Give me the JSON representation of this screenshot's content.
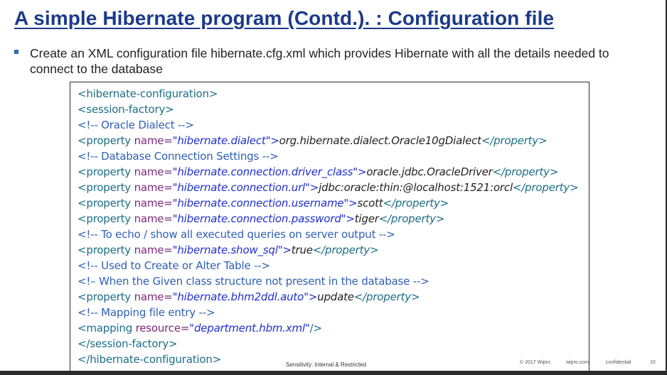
{
  "slide": {
    "title": "A simple Hibernate program (Contd.). : Configuration file",
    "bullet": "Create an XML configuration file hibernate.cfg.xml which provides Hibernate with all the details needed to connect to the database"
  },
  "code": {
    "l1": "<hibernate-configuration>",
    "l2": "<session-factory>",
    "l3": "<!-- Oracle Dialect -->",
    "l4": {
      "open": "<property ",
      "attr": "name=",
      "q1": "\"",
      "val": "hibernate.dialect",
      "q2": "\">",
      "text": "org.hibernate.dialect.Oracle10gDialect",
      "close": "</property>"
    },
    "l5": "<!-- Database Connection Settings -->",
    "l6": {
      "open": "<property ",
      "attr": "name=",
      "q1": "\"",
      "val": "hibernate.connection.driver_class",
      "q2": "\">",
      "text": "oracle.jdbc.OracleDriver",
      "close": "</property>"
    },
    "l7": {
      "open": "<property ",
      "attr": "name=",
      "q1": "\"",
      "val": "hibernate.connection.url",
      "q2": "\">",
      "text": "jdbc:oracle:thin:@localhost:1521:orcl",
      "close": "</property>"
    },
    "l8": {
      "open": "<property ",
      "attr": "name=",
      "q1": "\"",
      "val": "hibernate.connection.username",
      "q2": "\">",
      "text": "scott",
      "close": "</property>"
    },
    "l9": {
      "open": "<property ",
      "attr": "name=",
      "q1": "\"",
      "val": "hibernate.connection.password",
      "q2": "\">",
      "text": "tiger",
      "close": "</property>"
    },
    "l10": "<!-- To echo / show all executed queries on server output -->",
    "l11": {
      "open": "<property ",
      "attr": "name=",
      "q1": "\"",
      "val": "hibernate.show_sql",
      "q2": "\">",
      "text": "true",
      "close": "</property>"
    },
    "l12": "<!-- Used to Create or Alter Table  -->",
    "l13": "<!– When the Given class structure not present in the database -->",
    "l14": {
      "open": "<property ",
      "attr": "name=",
      "q1": "\"",
      "val": "hibernate.bhm2ddl.auto",
      "q2": "\">",
      "text": "update",
      "close": "</property>"
    },
    "l15": "<!-- Mapping file entry -->",
    "l16": {
      "open": "<mapping ",
      "attr": "resource=",
      "q1": "\"",
      "val": "department.hbm.xml",
      "q2": "\"",
      "close": "/>"
    },
    "l17": "</session-factory>",
    "l18": "</hibernate-configuration>"
  },
  "footer": {
    "sensitivity": "Sensitivity: Internal & Restricted",
    "copyright": "© 2017  Wipro",
    "site": "wipro.com",
    "confidential": "confidential",
    "page": "10"
  },
  "colors": {
    "title": "#1b3a8a",
    "bullet": "#2e6db4",
    "tag": "#1b6e86",
    "comment": "#2f5fb5",
    "attribute": "#7a2a7a",
    "value": "#1f2fd0"
  }
}
